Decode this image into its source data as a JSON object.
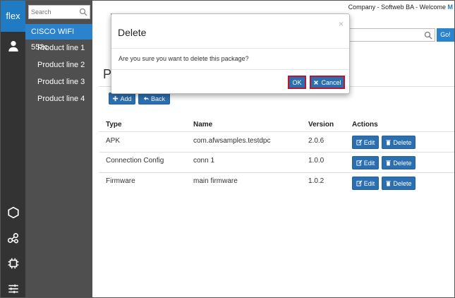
{
  "brand": {
    "logo_text": "flex",
    "color": "#1e7bc4"
  },
  "rail": {
    "icons": [
      "user-icon",
      "hexagon-icon",
      "network-icon",
      "chip-icon",
      "sliders-icon"
    ]
  },
  "nav": {
    "search_placeholder": "Search",
    "active_item": "CISCO WIFI 552c",
    "items": [
      {
        "label": "Product line 1"
      },
      {
        "label": "Product line 2"
      },
      {
        "label": "Product line 3"
      },
      {
        "label": "Product line 4"
      }
    ]
  },
  "header": {
    "welcome_text": "Company - Softweb BA - Welcome ",
    "welcome_user": "M",
    "go_label": "Go!"
  },
  "page": {
    "title_visible": "P",
    "add_label": "Add",
    "back_label": "Back"
  },
  "table": {
    "columns": [
      "Type",
      "Name",
      "Version",
      "Actions"
    ],
    "rows": [
      {
        "type": "APK",
        "name": "com.afwsamples.testdpc",
        "version": "2.0.6"
      },
      {
        "type": "Connection Config",
        "name": "conn 1",
        "version": "1.0.0"
      },
      {
        "type": "Firmware",
        "name": "main firmware",
        "version": "1.0.2"
      }
    ],
    "edit_label": "Edit",
    "delete_label": "Delete"
  },
  "modal": {
    "title": "Delete",
    "close_glyph": "×",
    "message": "Are you sure you want to delete this package?",
    "ok_label": "OK",
    "cancel_label": "Cancel"
  },
  "colors": {
    "primary": "#2b6fb0",
    "highlight_border": "#c0142d",
    "nav_bg": "#4f4f4f",
    "rail_bg": "#333333"
  }
}
